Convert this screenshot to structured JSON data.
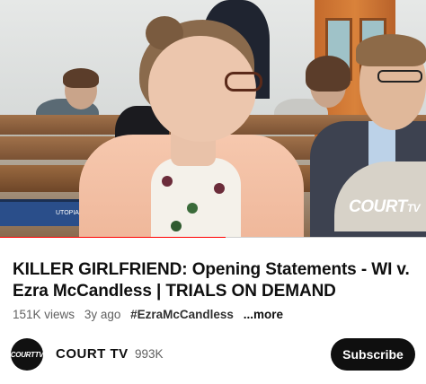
{
  "video": {
    "watermark_text": "COURT",
    "watermark_tv": "TV",
    "monitor_label": "UTOPIA",
    "progress_fraction": 0.53,
    "progress_color": "#ff0000"
  },
  "title": "KILLER GIRLFRIEND: Opening Statements - WI v. Ezra McCandless | TRIALS ON DEMAND",
  "meta": {
    "views": "151K views",
    "age": "3y ago",
    "hashtag": "#EzraMcCandless",
    "more": "...more"
  },
  "channel": {
    "avatar_text": "COURTTV",
    "name": "COURT TV",
    "subscribers": "993K",
    "subscribe_label": "Subscribe"
  },
  "colors": {
    "accent": "#ff0000",
    "text_primary": "#0f0f0f",
    "text_secondary": "#606060",
    "subscribe_bg": "#0f0f0f"
  }
}
